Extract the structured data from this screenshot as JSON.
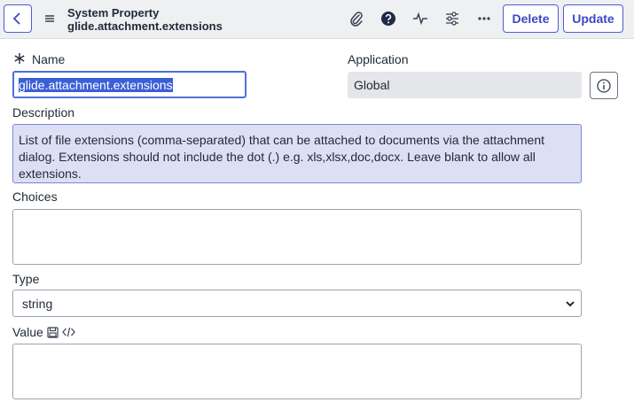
{
  "header": {
    "title_line1": "System Property",
    "title_line2": "glide.attachment.extensions",
    "delete_label": "Delete",
    "update_label": "Update",
    "icons": [
      "back-icon",
      "menu-icon",
      "paperclip-icon",
      "help-icon",
      "activity-icon",
      "settings-sliders-icon",
      "more-icon"
    ]
  },
  "form": {
    "name_label": "Name",
    "name_value": "glide.attachment.extensions",
    "application_label": "Application",
    "application_value": "Global",
    "description_label": "Description",
    "description_value": "List of file extensions (comma-separated) that can be attached to documents via the attachment dialog. Extensions should not include the dot (.) e.g. xls,xlsx,doc,docx. Leave blank to allow all extensions.",
    "choices_label": "Choices",
    "choices_value": "",
    "type_label": "Type",
    "type_value": "string",
    "value_label": "Value",
    "value_value": ""
  },
  "colors": {
    "accent": "#4f5bd5",
    "description_bg": "#dde0f5",
    "header_bg": "#eef0f2",
    "readonly_bg": "#e4e6e9"
  }
}
